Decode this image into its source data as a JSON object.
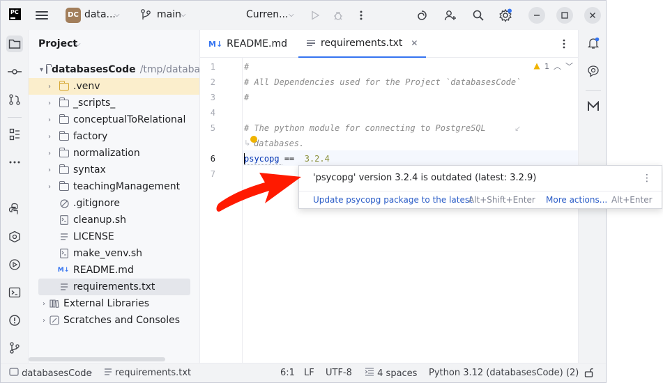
{
  "titlebar": {
    "logo_text": "PC",
    "project_badge": "DC",
    "project_name": "data...",
    "branch": "main",
    "run_config": "Curren..."
  },
  "project_panel": {
    "title": "Project",
    "root": {
      "name": "databasesCode",
      "path": "/tmp/databasesCode"
    },
    "items": [
      {
        "name": ".venv",
        "kind": "folder"
      },
      {
        "name": "_scripts_",
        "kind": "folder"
      },
      {
        "name": "conceptualToRelational",
        "kind": "folder"
      },
      {
        "name": "factory",
        "kind": "folder"
      },
      {
        "name": "normalization",
        "kind": "folder"
      },
      {
        "name": "syntax",
        "kind": "folder"
      },
      {
        "name": "teachingManagement",
        "kind": "folder"
      },
      {
        "name": ".gitignore",
        "kind": "file"
      },
      {
        "name": "cleanup.sh",
        "kind": "file"
      },
      {
        "name": "LICENSE",
        "kind": "file"
      },
      {
        "name": "make_venv.sh",
        "kind": "file"
      },
      {
        "name": "README.md",
        "kind": "file"
      },
      {
        "name": "requirements.txt",
        "kind": "file"
      }
    ],
    "external_libraries": "External Libraries",
    "scratches": "Scratches and Consoles"
  },
  "editor": {
    "tabs": [
      {
        "label": "README.md",
        "icon": "M↓"
      },
      {
        "label": "requirements.txt",
        "active": true
      }
    ],
    "inspection_count": "1",
    "lines": [
      {
        "n": "1",
        "text": "#"
      },
      {
        "n": "2",
        "text": "# All Dependencies used for the Project `databasesCode`"
      },
      {
        "n": "3",
        "text": "#"
      },
      {
        "n": "4",
        "text": ""
      },
      {
        "n": "5",
        "text": "# The python module for connecting to PostgreSQL"
      },
      {
        "n": "",
        "text": "databases."
      },
      {
        "n": "6",
        "pkg": "psycopg",
        "op": "==",
        "ver": "3.2.4"
      },
      {
        "n": "7",
        "text": ""
      }
    ]
  },
  "popup": {
    "message": "'psycopg' version 3.2.4 is outdated (latest: 3.2.9)",
    "action": "Update psycopg package to the latest",
    "action_shortcut": "Alt+Shift+Enter",
    "more": "More actions...",
    "more_shortcut": "Alt+Enter"
  },
  "statusbar": {
    "breadcrumb_project": "databasesCode",
    "breadcrumb_file": "requirements.txt",
    "position": "6:1",
    "line_sep": "LF",
    "encoding": "UTF-8",
    "indent": "4 spaces",
    "interpreter": "Python 3.12 (databasesCode) (2)"
  },
  "colors": {
    "accent": "#3574f0",
    "folder_excluded": "#d6a734",
    "annotation": "#ff1a00"
  }
}
